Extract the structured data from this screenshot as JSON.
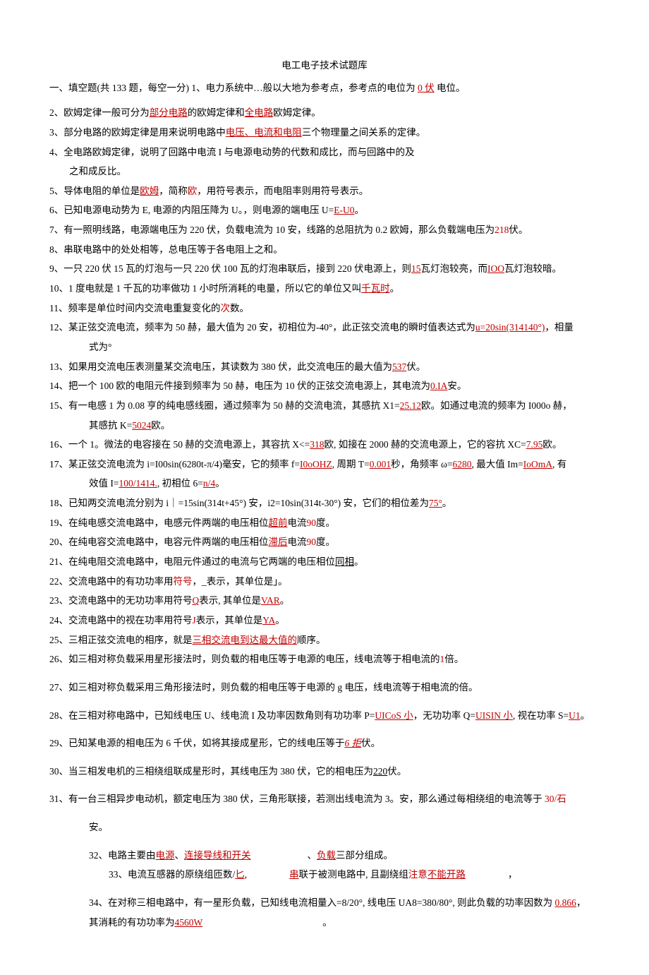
{
  "title": "电工电子技术试题库",
  "section_header": "一、填空题(共 133 题，每空一分) 1、电力系统中…般以大地为参考点，参考点的电位为",
  "a1": "0 伏",
  "t1b": "电位。",
  "q2a": "2、欧姆定律一般可分为",
  "a2a": "部分电路",
  "q2b": "的欧姆定律和",
  "a2b": "全电路",
  "q2c": "欧姆定律。",
  "q3a": "3、部分电路的欧姆定律是用来说明电路中",
  "a3": "电压、电流和电阻",
  "q3b": "三个物理量之间关系的定律。",
  "q4": "4、全电路欧姆定律，说明了回路中电流 I 与电源电动势的代数和成比，而与回路中的及",
  "q4b": "之和成反比。",
  "q5a": "5、导体电阻的单位是",
  "a5a": "欧姆",
  "q5b": "，简称",
  "a5b": "欧",
  "q5c": "，用符号表示，而电阻率则用符号表示。",
  "q6a": "6、已知电源电动势为 E, 电源的内阻压降为 U。，则电源的端电压 U=",
  "a6": "E-U0",
  "q6b": "。",
  "q7a": "7、有一照明线路，电源端电压为 220 伏，负载电流为 10 安，线路的总阻抗为 0.2 欧姆，那么负载端电压为",
  "a7": "218",
  "q7b": "伏。",
  "q8": "8、串联电路中的处处相等，总电压等于各电阻上之和。",
  "q9a": "9、一只 220 伏 15 瓦的灯泡与一只 220 伏 100 瓦的灯泡串联后，接到 220 伏电源上，则",
  "a9a": "15",
  "q9b": "瓦灯泡较亮，而",
  "a9b": "IOO",
  "q9c": "瓦灯泡较暗。",
  "q10a": "10、1 度电就是 1 千瓦的功率做功 1 小时所消耗的电量，所以它的单位又叫",
  "a10": "千瓦时",
  "q10b": "。",
  "q11a": "11、频率是单位时间内交流电重复变化的",
  "a11": "次",
  "q11b": "数。",
  "q12a": "12、某正弦交流电流，频率为 50 赫，最大值为 20 安，初相位为-40°，此正弦交流电的瞬时值表达式为",
  "a12": "u=20sin(314140°)",
  "q12b": "，相量",
  "q12c": "式为°",
  "q13a": "13、如果用交流电压表测量某交流电压，其读数为 380 伏，此交流电压的最大值为",
  "a13": "537",
  "q13b": "伏。",
  "q14a": "14、把一个 100 欧的电阻元件接到频率为 50 赫，电压为 10 伏的正弦交流电源上，其电流为",
  "a14": "0.IA",
  "q14b": "安。",
  "q15a": "15、有一电感 1 为 0.08 亨的纯电感线圈，通过频率为 50 赫的交流电流，其感抗 X1=",
  "a15a": "25.12",
  "q15b": "欧。如通过电流的频率为 I000o 赫，",
  "q15c": "其感抗 K=",
  "a15b": "5024",
  "q15d": "欧。",
  "q16a": "16、一个 1。微法的电容接在 50 赫的交流电源上，其容抗 X<=",
  "a16a": "318",
  "q16b": "欧, 如接在 2000 赫的交流电源上，它的容抗 XC=",
  "a16b": "7.95",
  "q16c": "欧。",
  "q17a": "17、某正弦交流电流为 i=I00sin(6280t-π/4)毫安，它的频率 f=",
  "a17a": "I0oOHZ",
  "q17b": ", 周期 T=",
  "a17b": "0.001",
  "q17c": "秒，角频率 ω=",
  "a17c": "6280",
  "q17d": ", 最大值 Im=",
  "a17d": "IoOmA",
  "q17e": ", 有",
  "q17f": "效值 I=",
  "a17e": "100/1414.",
  "q17g": ", 初相位 6=",
  "a17f": "n/4",
  "q17h": "。",
  "q18a": "18、已知两交流电流分别为 i｜=15sin(314t+45°) 安，i2=10sin(314t-30°) 安，它们的相位差为",
  "a18": "75°",
  "q18b": "。",
  "q19a": "19、在纯电感交流电路中，电感元件两端的电压相位",
  "a19a": "超前",
  "q19b": "电流",
  "a19b": "90",
  "q19c": "度。",
  "q20a": "20、在纯电容交流电路中，电容元件两端的电压相位",
  "a20a": "滞后",
  "q20b": "电流",
  "a20b": "90",
  "q20c": "度。",
  "q21a": "21、在纯电阻交流电路中，电阻元件通过的电流与它两端的电压相位",
  "a21": "同相",
  "q21b": "。",
  "q22a": "22、交流电路中的有功功率用",
  "a22": "符号",
  "q22b": "，_表示，其单位是」。",
  "q23a": "23、交流电路中的无功功率用符号",
  "a23a": "Q",
  "q23b": "表示, 其单位是",
  "a23b": "VAR",
  "q23c": "。",
  "q24a": "24、交流电路中的视在功率用符号",
  "a24a": "J",
  "q24b": "表示，其单位是",
  "a24b": "YA",
  "q24c": "。",
  "q25a": "25、三相正弦交流电的相序，就是",
  "a25": "三相交流电到达最大值的",
  "q25b": "顺序。",
  "q26a": "26、如三相对称负载采用星形接法时，则负载的相电压等于电源的电压，线电流等于相电流的",
  "a26": "1",
  "q26b": "倍。",
  "q27": "27、如三相对称负载采用三角形接法时，则负载的相电压等于电源的 g 电压，线电流等于相电流的倍。",
  "q28a": "28、在三相对称电路中，已知线电压 U、线电流 I 及功率因数角则有功功率 P=",
  "a28a": "UICoS 小",
  "q28b": "，无功功率 Q=",
  "a28b": "UISIN 小",
  "q28c": ", 视在功率 S=",
  "a28c": "U1",
  "q28d": "。",
  "q29a": "29、已知某电源的相电压为 6 千伏，如将其接成星形，它的线电压等于",
  "a29": "6 拒",
  "q29b": "伏。",
  "q30a": "30、当三相发电机的三相绕组联成星形时，其线电压为 380 伏，它的相电压为",
  "a30": "220",
  "q30b": "伏。",
  "q31a": "31、有一台三相异步电动机，额定电压为 380 伏，三角形联接，若测出线电流为 3。安，那么通过每相绕组的电流等于",
  "a31": "30/石",
  "q31b": "安。",
  "q32a": "32、电路主要由",
  "a32a": "电源",
  "q32b": "、",
  "a32b": "连接导线和开关",
  "q32c": "、",
  "a32c": "负载",
  "q32d": "三部分组成。",
  "q33a": "33、电流互感器的原绕组匝数/",
  "a33a": "匕",
  "q33b": ",",
  "a33b": "串",
  "q33c": "联于被测电路中, 且副绕组",
  "a33c": "注意不能开路",
  "q33d": "，",
  "q34a": "34、在对称三相电路中，有一星形负载，已知线电流相量入=8/20°, 线电压 UA8=380/80°, 则此负载的功率因数为",
  "a34a": "0.866",
  "q34b": "，",
  "q34c": "其消耗的有功功率为",
  "a34b": "4560W",
  "q34d": "。"
}
